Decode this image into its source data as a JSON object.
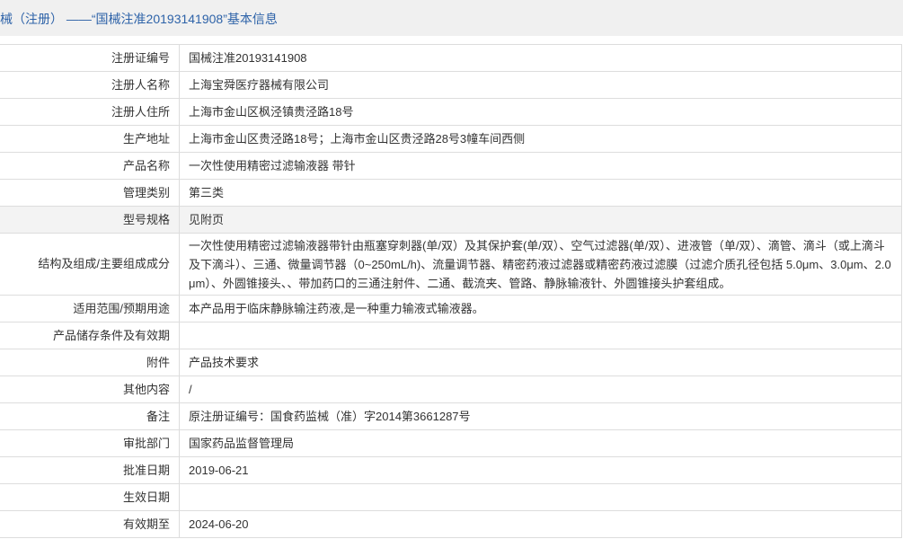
{
  "header": {
    "title": "械（注册） ——“国械注准20193141908”基本信息"
  },
  "colors": {
    "header_background": "#f0f0f0",
    "header_text": "#2d62a8",
    "text": "#333333",
    "border": "#dddddd",
    "highlight_row": "#f3f3f3"
  },
  "rows": [
    {
      "label": "注册证编号",
      "value": "国械注准20193141908"
    },
    {
      "label": "注册人名称",
      "value": "上海宝舜医疗器械有限公司"
    },
    {
      "label": "注册人住所",
      "value": "上海市金山区枫泾镇贵泾路18号"
    },
    {
      "label": "生产地址",
      "value": "上海市金山区贵泾路18号；上海市金山区贵泾路28号3幢车间西侧"
    },
    {
      "label": "产品名称",
      "value": "一次性使用精密过滤输液器 带针"
    },
    {
      "label": "管理类别",
      "value": "第三类"
    },
    {
      "label": "型号规格",
      "value": "见附页"
    },
    {
      "label": "结构及组成/主要组成成分",
      "value": "一次性使用精密过滤输液器带针由瓶塞穿刺器(单/双）及其保护套(单/双）、空气过滤器(单/双）、进液管（单/双）、滴管、滴斗（或上滴斗及下滴斗）、三通、微量调节器（0~250mL/h)、流量调节器、精密药液过滤器或精密药液过滤膜（过滤介质孔径包括 5.0μm、3.0μm、2.0μm）、外圆锥接头、、带加药口的三通注射件、二通、截流夹、管路、静脉输液针、外圆锥接头护套组成。"
    },
    {
      "label": "适用范围/预期用途",
      "value": "本产品用于临床静脉输注药液,是一种重力输液式输液器。"
    },
    {
      "label": "产品储存条件及有效期",
      "value": ""
    },
    {
      "label": "附件",
      "value": "产品技术要求"
    },
    {
      "label": "其他内容",
      "value": "/"
    },
    {
      "label": "备注",
      "value": "原注册证编号：国食药监械（准）字2014第3661287号"
    },
    {
      "label": "审批部门",
      "value": "国家药品监督管理局"
    },
    {
      "label": "批准日期",
      "value": "2019-06-21"
    },
    {
      "label": "生效日期",
      "value": ""
    },
    {
      "label": "有效期至",
      "value": "2024-06-20"
    }
  ]
}
